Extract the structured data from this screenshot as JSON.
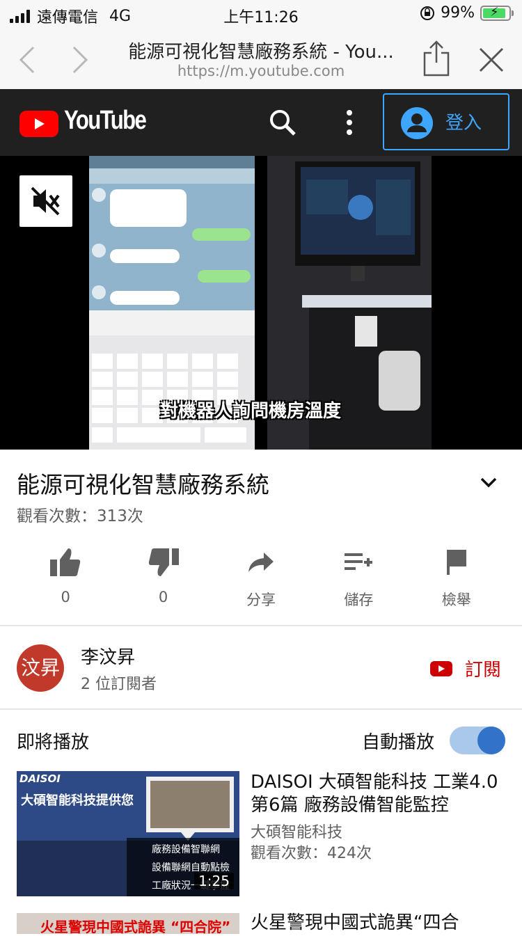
{
  "status_bar": {
    "carrier": "遠傳電信",
    "network": "4G",
    "time": "上午11:26",
    "battery": "99%"
  },
  "browser": {
    "page_title": "能源可視化智慧廠務系統 - You...",
    "url": "https://m.youtube.com"
  },
  "youtube": {
    "logo_text": "YouTube",
    "signin_label": "登入",
    "accent": "#3ea6ff",
    "brand_red": "#ff0000"
  },
  "video": {
    "caption": "對機器人詢問機房溫度",
    "title": "能源可視化智慧廠務系統",
    "views": "觀看次數：313次"
  },
  "actions": [
    {
      "icon": "thumbs-up-icon",
      "label": "0"
    },
    {
      "icon": "thumbs-down-icon",
      "label": "0"
    },
    {
      "icon": "share-icon",
      "label": "分享"
    },
    {
      "icon": "add-to-playlist-icon",
      "label": "儲存"
    },
    {
      "icon": "flag-icon",
      "label": "檢舉"
    }
  ],
  "channel": {
    "avatar_text": "汶昇",
    "name": "李汶昇",
    "subscribers": "2 位訂閱者",
    "subscribe_label": "訂閱"
  },
  "up_next": {
    "heading": "即將播放",
    "autoplay_label": "自動播放",
    "autoplay_on": true
  },
  "related": [
    {
      "title": "DAISOI 大碩智能科技 工業4.0 第6篇 廠務設備智能監控",
      "channel": "大碩智能科技",
      "views": "觀看次數：424次",
      "duration": "1:25",
      "thumb_brand": "DAISOI",
      "thumb_heading": "大碩智能科技提供您",
      "thumb_lines": [
        "廠務設備智聯網",
        "設備聯網自動點檢",
        "工廠狀況一鍵掌握"
      ]
    },
    {
      "title": "火星警現中國式詭異“四合",
      "thumb_text": "火星警現中國式詭異 “四合院”"
    }
  ]
}
